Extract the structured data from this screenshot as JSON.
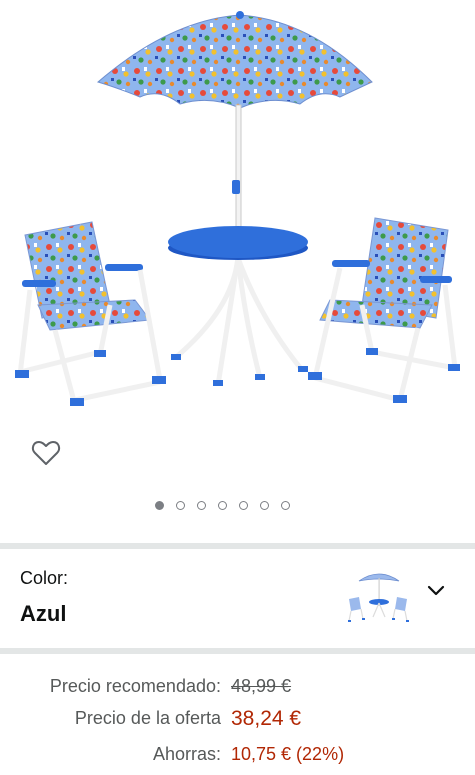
{
  "product": {
    "image_alt": "Set de mesa infantil con sombrilla y dos sillas plegables"
  },
  "gallery": {
    "total_images": 7,
    "active_index": 0
  },
  "variant": {
    "label": "Color:",
    "value": "Azul"
  },
  "pricing": {
    "recommended_label": "Precio recomendado:",
    "recommended_value": "48,99 €",
    "offer_label": "Precio de la oferta",
    "offer_value": "38,24 €",
    "savings_label": "Ahorras:",
    "savings_value": "10,75 € (22%)"
  },
  "colors": {
    "price_red": "#b12704",
    "separator": "#e3e6e6",
    "table_blue": "#2f6fdb"
  },
  "icons": {
    "wishlist": "heart-outline-icon",
    "dropdown": "chevron-down-icon"
  }
}
